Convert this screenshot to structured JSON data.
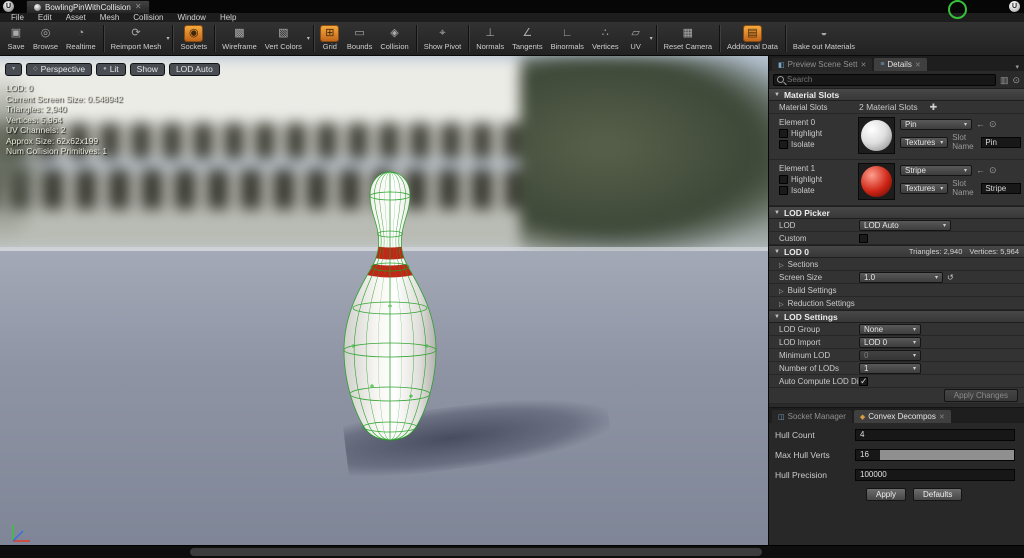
{
  "window": {
    "tab_title": "BowlingPinWithCollision",
    "menus": [
      "File",
      "Edit",
      "Asset",
      "Mesh",
      "Collision",
      "Window",
      "Help"
    ]
  },
  "toolbar": {
    "buttons": [
      {
        "label": "Save",
        "glyph": "▣"
      },
      {
        "label": "Browse",
        "glyph": "◎"
      },
      {
        "label": "Realtime",
        "glyph": "◔"
      },
      {
        "label": "Reimport Mesh",
        "glyph": "⟳"
      },
      {
        "label": "Sockets",
        "glyph": "◉"
      },
      {
        "label": "Wireframe",
        "glyph": "▩"
      },
      {
        "label": "Vert Colors",
        "glyph": "▧"
      },
      {
        "label": "Grid",
        "glyph": "⊞"
      },
      {
        "label": "Bounds",
        "glyph": "▭"
      },
      {
        "label": "Collision",
        "glyph": "◈"
      },
      {
        "label": "Show Pivot",
        "glyph": "⌖"
      },
      {
        "label": "Normals",
        "glyph": "⊥"
      },
      {
        "label": "Tangents",
        "glyph": "∠"
      },
      {
        "label": "Binormals",
        "glyph": "∟"
      },
      {
        "label": "Vertices",
        "glyph": "∴"
      },
      {
        "label": "UV",
        "glyph": "▱"
      },
      {
        "label": "Reset Camera",
        "glyph": "▦"
      },
      {
        "label": "Additional Data",
        "glyph": "▤"
      },
      {
        "label": "Bake out Materials",
        "glyph": "◒"
      }
    ]
  },
  "viewport": {
    "overlay": {
      "perspective": "Perspective",
      "lit": "Lit",
      "show": "Show",
      "lod_auto": "LOD Auto"
    },
    "stats": [
      "LOD: 0",
      "Current Screen Size: 0.548942",
      "Triangles: 2,940",
      "Vertices: 5,964",
      "UV Channels: 2",
      "Approx Size: 62x62x199",
      "Num Collision Primitives: 1"
    ]
  },
  "details": {
    "tabs": {
      "preview": "Preview Scene Sett",
      "details": "Details"
    },
    "search_placeholder": "Search",
    "material_slots": {
      "header": "Material Slots",
      "row_label": "Material Slots",
      "count_label": "2 Material Slots",
      "elements": [
        {
          "label": "Element 0",
          "highlight": "Highlight",
          "isolate": "Isolate",
          "material": "Pin",
          "textures": "Textures",
          "slot_name_label": "Slot Name",
          "slot_name": "Pin"
        },
        {
          "label": "Element 1",
          "highlight": "Highlight",
          "isolate": "Isolate",
          "material": "Stripe",
          "textures": "Textures",
          "slot_name_label": "Slot Name",
          "slot_name": "Stripe"
        }
      ]
    },
    "lod_picker": {
      "header": "LOD Picker",
      "lod_label": "LOD",
      "lod_value": "LOD Auto",
      "custom_label": "Custom"
    },
    "lod0": {
      "header": "LOD 0",
      "tri": "Triangles: 2,940",
      "vert": "Vertices: 5,964",
      "sections": "Sections",
      "screen_size_label": "Screen Size",
      "screen_size_value": "1.0",
      "build_settings": "Build Settings",
      "reduction_settings": "Reduction Settings"
    },
    "lod_settings": {
      "header": "LOD Settings",
      "lod_group_label": "LOD Group",
      "lod_group_value": "None",
      "lod_import_label": "LOD Import",
      "lod_import_value": "LOD 0",
      "min_lod_label": "Minimum LOD",
      "min_lod_value": "0",
      "num_lods_label": "Number of LODs",
      "num_lods_value": "1",
      "auto_compute_label": "Auto Compute LOD Distance",
      "apply_changes": "Apply Changes"
    }
  },
  "bottom_panel": {
    "tabs": {
      "socket_manager": "Socket Manager",
      "convex": "Convex Decompos"
    },
    "hull_count_label": "Hull Count",
    "hull_count_value": "4",
    "max_hull_verts_label": "Max Hull Verts",
    "max_hull_verts_value": "16",
    "hull_precision_label": "Hull Precision",
    "hull_precision_value": "100000",
    "apply": "Apply",
    "defaults": "Defaults"
  },
  "colors": {
    "accent_orange": "#d97b1e",
    "collision_green": "#219e21",
    "stripe_red": "#c52418"
  }
}
